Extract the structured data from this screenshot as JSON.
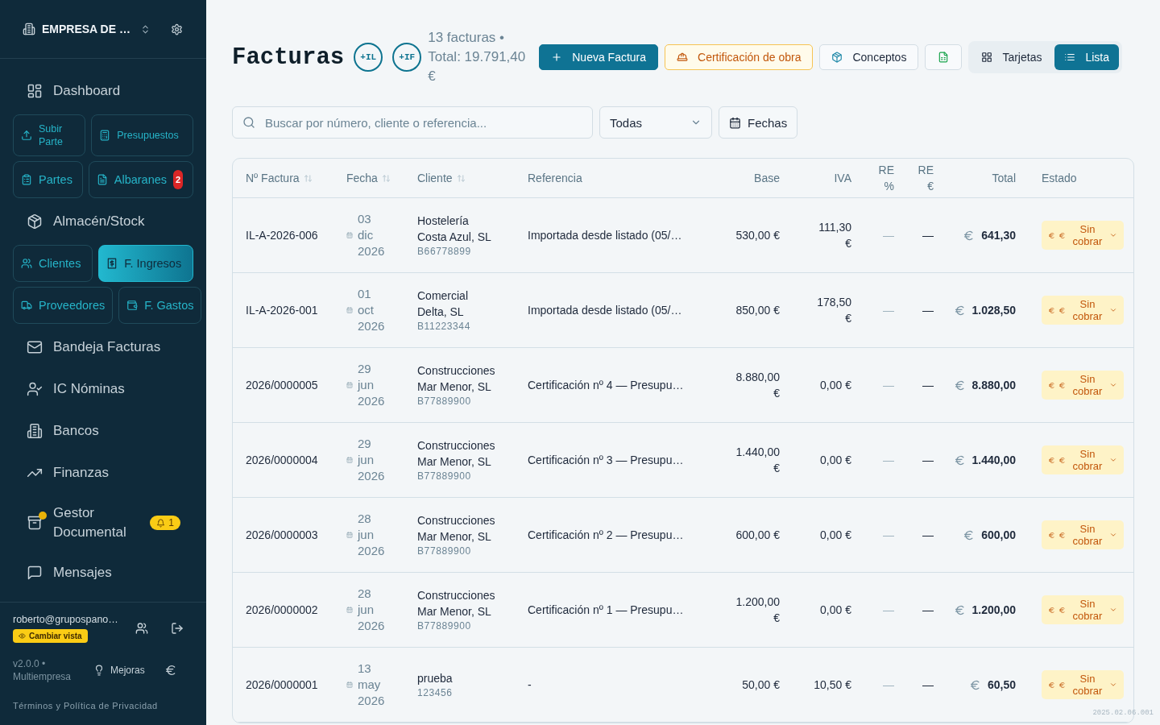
{
  "sidebar": {
    "company": "EMPRESA DE …",
    "nav": [
      {
        "kind": "link",
        "label": "Dashboard",
        "selected": false
      },
      {
        "kind": "tiles",
        "tiles": [
          {
            "label": "Subir Parte",
            "selected": false
          },
          {
            "label": "Presupuestos",
            "selected": false
          }
        ]
      },
      {
        "kind": "tiles",
        "tiles": [
          {
            "label": "Partes",
            "selected": false
          },
          {
            "label": "Albaranes",
            "selected": false,
            "badge": "2"
          }
        ]
      },
      {
        "kind": "link",
        "label": "Almacén/Stock",
        "selected": false
      },
      {
        "kind": "tiles",
        "tiles": [
          {
            "label": "Clientes",
            "selected": false
          },
          {
            "label": "F. Ingresos",
            "selected": true
          }
        ]
      },
      {
        "kind": "tiles",
        "tiles": [
          {
            "label": "Proveedores",
            "selected": false
          },
          {
            "label": "F. Gastos",
            "selected": false
          }
        ]
      },
      {
        "kind": "link",
        "label": "Bandeja Facturas",
        "selected": false
      },
      {
        "kind": "link",
        "label": "IC Nóminas",
        "selected": false
      },
      {
        "kind": "link",
        "label": "Bancos",
        "selected": false
      },
      {
        "kind": "link",
        "label": "Finanzas",
        "selected": false
      },
      {
        "kind": "link",
        "label": "Gestor Documental",
        "selected": false,
        "unread": true,
        "badge": "1"
      },
      {
        "kind": "link",
        "label": "Mensajes",
        "selected": false
      }
    ],
    "user": {
      "email": "roberto@grupospano…",
      "switch_view": "Cambiar vista"
    },
    "version": "v2.0.0 • Multiempresa",
    "improvements": "Mejoras",
    "legal": "Términos y Política de Privacidad"
  },
  "header": {
    "title": "Facturas",
    "quick_buttons": [
      "+IL",
      "+IF"
    ],
    "summary": "13 facturas • Total: 19.791,40 €",
    "actions": [
      {
        "kind": "primary",
        "label": "Nueva Factura"
      },
      {
        "kind": "warning",
        "label": "Certificación de obra"
      },
      {
        "kind": "default",
        "label": "Conceptos"
      },
      {
        "kind": "icon"
      }
    ],
    "views": [
      {
        "label": "Tarjetas",
        "selected": false
      },
      {
        "label": "Lista",
        "selected": true
      }
    ]
  },
  "filters": {
    "search": {
      "placeholder": "Buscar por número, cliente o referencia..."
    },
    "status": "Todas",
    "dates": "Fechas"
  },
  "table": {
    "columns": [
      {
        "label": "Nº Factura",
        "sortable": true
      },
      {
        "label": "Fecha",
        "sortable": true
      },
      {
        "label": "Cliente",
        "sortable": true
      },
      {
        "label": "Referencia",
        "sortable": false
      },
      {
        "label": "Base",
        "sortable": false
      },
      {
        "label": "IVA",
        "sortable": false
      },
      {
        "label": "RE %",
        "sortable": false
      },
      {
        "label": "RE €",
        "sortable": false
      },
      {
        "label": "Total",
        "sortable": false
      },
      {
        "label": "Estado",
        "sortable": false
      }
    ],
    "rows": [
      {
        "number": "IL-A-2026-006",
        "date": "03 dic 2026",
        "client": "Hostelería Costa Azul, SL",
        "tax_id": "B66778899",
        "reference": "Importada desde listado (05/…",
        "base": "530,00 €",
        "iva": "111,30 €",
        "re_pct": "—",
        "re_amount": "—",
        "total": "641,30",
        "status": "Sin cobrar"
      },
      {
        "number": "IL-A-2026-001",
        "date": "01 oct 2026",
        "client": "Comercial Delta, SL",
        "tax_id": "B11223344",
        "reference": "Importada desde listado (05/…",
        "base": "850,00 €",
        "iva": "178,50 €",
        "re_pct": "—",
        "re_amount": "—",
        "total": "1.028,50",
        "status": "Sin cobrar"
      },
      {
        "number": "2026/0000005",
        "date": "29 jun 2026",
        "client": "Construcciones Mar Menor, SL",
        "tax_id": "B77889900",
        "reference": "Certificación nº 4 — Presupu…",
        "base": "8.880,00 €",
        "iva": "0,00 €",
        "re_pct": "—",
        "re_amount": "—",
        "total": "8.880,00",
        "status": "Sin cobrar"
      },
      {
        "number": "2026/0000004",
        "date": "29 jun 2026",
        "client": "Construcciones Mar Menor, SL",
        "tax_id": "B77889900",
        "reference": "Certificación nº 3 — Presupu…",
        "base": "1.440,00 €",
        "iva": "0,00 €",
        "re_pct": "—",
        "re_amount": "—",
        "total": "1.440,00",
        "status": "Sin cobrar"
      },
      {
        "number": "2026/0000003",
        "date": "28 jun 2026",
        "client": "Construcciones Mar Menor, SL",
        "tax_id": "B77889900",
        "reference": "Certificación nº 2 — Presupu…",
        "base": "600,00 €",
        "iva": "0,00 €",
        "re_pct": "—",
        "re_amount": "—",
        "total": "600,00",
        "status": "Sin cobrar"
      },
      {
        "number": "2026/0000002",
        "date": "28 jun 2026",
        "client": "Construcciones Mar Menor, SL",
        "tax_id": "B77889900",
        "reference": "Certificación nº 1 — Presupu…",
        "base": "1.200,00 €",
        "iva": "0,00 €",
        "re_pct": "—",
        "re_amount": "—",
        "total": "1.200,00",
        "status": "Sin cobrar"
      },
      {
        "number": "2026/0000001",
        "date": "13 may 2026",
        "client": "prueba",
        "tax_id": "123456",
        "reference": "-",
        "base": "50,00 €",
        "iva": "10,50 €",
        "re_pct": "—",
        "re_amount": "—",
        "total": "60,50",
        "status": "Sin cobrar"
      }
    ]
  },
  "build_label": "2025.02.06.001"
}
